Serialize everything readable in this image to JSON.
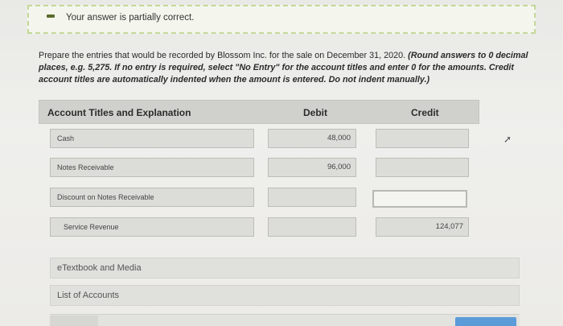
{
  "banner": {
    "text": "Your answer is partially correct."
  },
  "instructions": {
    "lead": "Prepare the entries that would be recorded by Blossom Inc. for the sale on December 31, 2020.",
    "emphasis": "(Round answers to 0 decimal places, e.g. 5,275. If no entry is required, select \"No Entry\" for the account titles and enter 0 for the amounts. Credit account titles are automatically indented when the amount is entered. Do not indent manually.)"
  },
  "table": {
    "headers": {
      "account": "Account Titles and Explanation",
      "debit": "Debit",
      "credit": "Credit"
    },
    "rows": [
      {
        "account": "Cash",
        "debit": "48,000",
        "credit": ""
      },
      {
        "account": "Notes Receivable",
        "debit": "96,000",
        "credit": ""
      },
      {
        "account": "Discount on Notes Receivable",
        "debit": "",
        "credit": ""
      },
      {
        "account": "Service Revenue",
        "debit": "",
        "credit": "124,077"
      }
    ]
  },
  "links": {
    "etextbook": "eTextbook and Media",
    "accounts": "List of Accounts"
  },
  "icons": {
    "status": "minus-icon",
    "cursor": "mouse-cursor-icon"
  }
}
